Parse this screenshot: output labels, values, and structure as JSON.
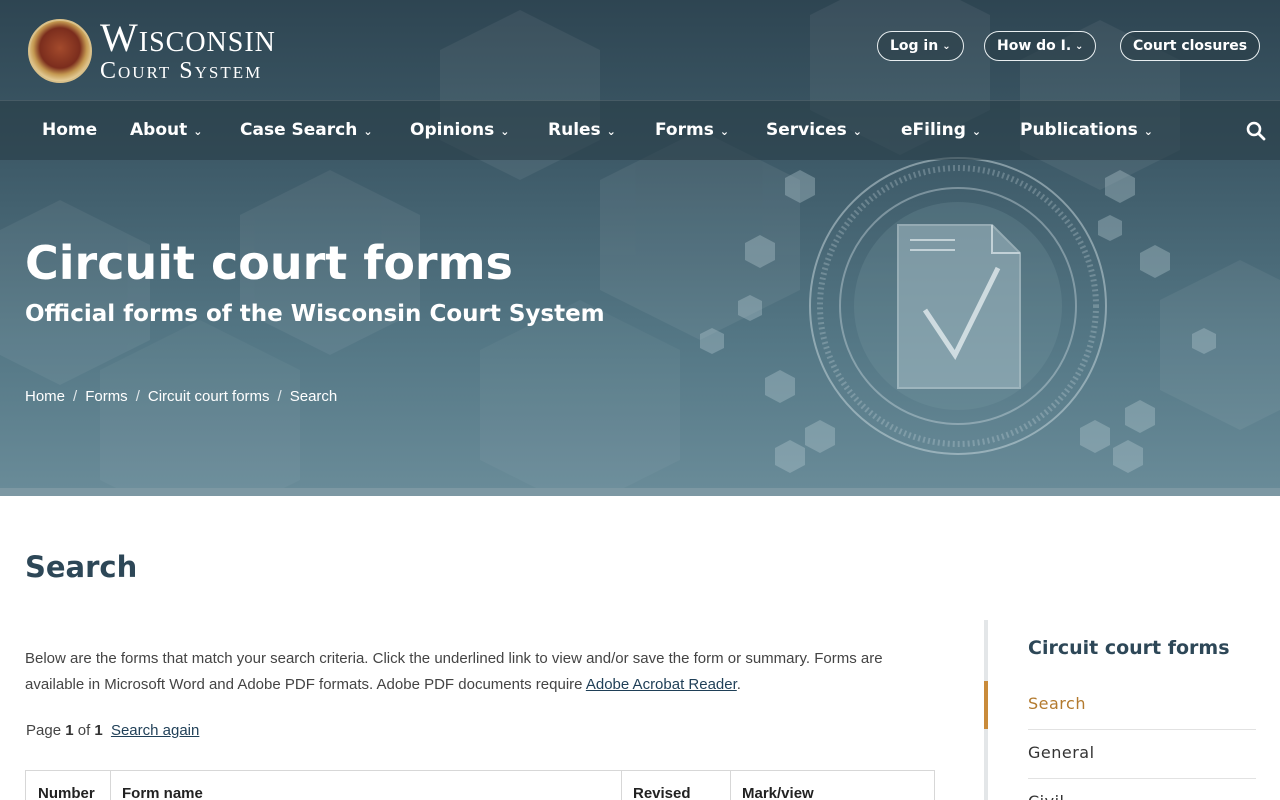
{
  "header": {
    "logo_line1": "Wisconsin",
    "logo_line2": "Court System",
    "utility_links": [
      {
        "label": "Log in",
        "has_dropdown": true
      },
      {
        "label": "How do I...",
        "has_dropdown": true
      },
      {
        "label": "Court closures",
        "has_dropdown": false
      }
    ]
  },
  "nav": {
    "items": [
      {
        "label": "Home",
        "has_dropdown": false
      },
      {
        "label": "About",
        "has_dropdown": true
      },
      {
        "label": "Case Search",
        "has_dropdown": true
      },
      {
        "label": "Opinions",
        "has_dropdown": true
      },
      {
        "label": "Rules",
        "has_dropdown": true
      },
      {
        "label": "Forms",
        "has_dropdown": true
      },
      {
        "label": "Services",
        "has_dropdown": true
      },
      {
        "label": "eFiling",
        "has_dropdown": true
      },
      {
        "label": "Publications",
        "has_dropdown": true
      }
    ],
    "search_icon": "search-icon"
  },
  "hero": {
    "title": "Circuit court forms",
    "subtitle": "Official forms of the Wisconsin Court System",
    "breadcrumbs": [
      "Home",
      "Forms",
      "Circuit court forms",
      "Search"
    ]
  },
  "main": {
    "heading": "Search",
    "intro_text": "Below are the forms that match your search criteria. Click the underlined link to view and/or save the form or summary. Forms are available in Microsoft Word and Adobe PDF formats. Adobe PDF documents require ",
    "intro_link": "Adobe Acrobat Reader",
    "intro_end": ".",
    "pager": {
      "prefix": "Page",
      "current": "1",
      "of": "of",
      "total": "1",
      "search_again": "Search again"
    },
    "table_headers": [
      "Number",
      "Form name",
      "Revised",
      "Mark/view"
    ]
  },
  "sidebar": {
    "title": "Circuit court forms",
    "items": [
      {
        "label": "Search",
        "active": true
      },
      {
        "label": "General",
        "active": false
      },
      {
        "label": "Civil",
        "active": false
      }
    ]
  },
  "colors": {
    "heading": "#2d4757",
    "link": "#1f3f57",
    "sidebar_active": "#c98b3a"
  }
}
